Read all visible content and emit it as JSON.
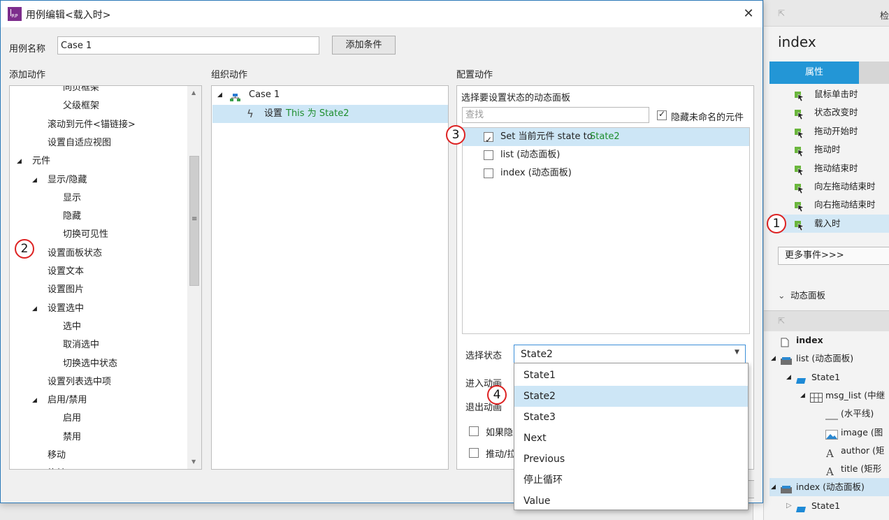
{
  "dialog": {
    "title": "用例编辑<载入时>",
    "case_name_label": "用例名称",
    "case_name_value": "Case 1",
    "add_condition_button": "添加条件",
    "col_add_action": "添加动作",
    "col_organize_action": "组织动作",
    "col_configure_action": "配置动作"
  },
  "add_action_tree": [
    {
      "label": "同页框架",
      "indent": 3,
      "expander": ""
    },
    {
      "label": "父级框架",
      "indent": 3,
      "expander": ""
    },
    {
      "label": "滚动到元件<锚链接>",
      "indent": 2,
      "expander": ""
    },
    {
      "label": "设置自适应视图",
      "indent": 2,
      "expander": ""
    },
    {
      "label": "元件",
      "indent": 1,
      "expander": "◢"
    },
    {
      "label": "显示/隐藏",
      "indent": 2,
      "expander": "◢"
    },
    {
      "label": "显示",
      "indent": 3,
      "expander": ""
    },
    {
      "label": "隐藏",
      "indent": 3,
      "expander": ""
    },
    {
      "label": "切换可见性",
      "indent": 3,
      "expander": ""
    },
    {
      "label": "设置面板状态",
      "indent": 2,
      "expander": ""
    },
    {
      "label": "设置文本",
      "indent": 2,
      "expander": ""
    },
    {
      "label": "设置图片",
      "indent": 2,
      "expander": ""
    },
    {
      "label": "设置选中",
      "indent": 2,
      "expander": "◢"
    },
    {
      "label": "选中",
      "indent": 3,
      "expander": ""
    },
    {
      "label": "取消选中",
      "indent": 3,
      "expander": ""
    },
    {
      "label": "切换选中状态",
      "indent": 3,
      "expander": ""
    },
    {
      "label": "设置列表选中项",
      "indent": 2,
      "expander": ""
    },
    {
      "label": "启用/禁用",
      "indent": 2,
      "expander": "◢"
    },
    {
      "label": "启用",
      "indent": 3,
      "expander": ""
    },
    {
      "label": "禁用",
      "indent": 3,
      "expander": ""
    },
    {
      "label": "移动",
      "indent": 2,
      "expander": ""
    },
    {
      "label": "旋转",
      "indent": 2,
      "expander": ""
    }
  ],
  "organize": {
    "case_label": "Case 1",
    "action_prefix": "设置",
    "action_target": "This 为 State2"
  },
  "configure": {
    "panel_title": "选择要设置状态的动态面板",
    "search_placeholder": "查找",
    "hide_unnamed_label": "隐藏未命名的元件",
    "items": [
      {
        "prefix": "Set 当前元件 state to ",
        "suffix": "State2",
        "checked": true
      },
      {
        "prefix": "list (动态面板)",
        "suffix": "",
        "checked": false
      },
      {
        "prefix": "index (动态面板)",
        "suffix": "",
        "checked": false
      }
    ],
    "select_state_label": "选择状态",
    "select_state_value": "State2",
    "enter_anim_label": "进入动画",
    "exit_anim_label": "退出动画",
    "if_hidden_label": "如果隐",
    "push_label": "推动/拉"
  },
  "state_dropdown": {
    "options": [
      "State1",
      "State2",
      "State3",
      "Next",
      "Previous",
      "停止循环",
      "Value"
    ],
    "selected": "State2"
  },
  "badges": [
    "1",
    "2",
    "3",
    "4"
  ],
  "right_panel": {
    "header_cut": "检",
    "title": "index",
    "tab_active": "属性",
    "events": [
      "鼠标单击时",
      "状态改变时",
      "拖动开始时",
      "拖动时",
      "拖动结束时",
      "向左拖动结束时",
      "向右拖动结束时",
      "载入时"
    ],
    "selected_event": "载入时",
    "more_events": "更多事件>>>",
    "section_dynamic_panel": "动态面板",
    "outline": [
      {
        "label": "index",
        "indent": 0,
        "icon": "page-icon",
        "bold": true
      },
      {
        "label": "list (动态面板)",
        "indent": 0,
        "icon": "dynamic-panel-icon",
        "bold": false
      },
      {
        "label": "State1",
        "indent": 1,
        "icon": "state-icon",
        "bold": false
      },
      {
        "label": "msg_list (中继",
        "indent": 2,
        "icon": "repeater-icon",
        "bold": false
      },
      {
        "label": "(水平线)",
        "indent": 3,
        "icon": "line-icon",
        "bold": false
      },
      {
        "label": "image (图",
        "indent": 3,
        "icon": "image-icon",
        "bold": false
      },
      {
        "label": "author (矩",
        "indent": 3,
        "icon": "text-icon",
        "bold": false
      },
      {
        "label": "title (矩形",
        "indent": 3,
        "icon": "text-icon",
        "bold": false
      },
      {
        "label": "index (动态面板)",
        "indent": 0,
        "icon": "dynamic-panel-icon",
        "bold": false
      },
      {
        "label": "State1",
        "indent": 1,
        "icon": "state-icon",
        "bold": false
      }
    ]
  },
  "colors": {
    "accent": "#2396d6",
    "selection": "#cde6f6",
    "green_text": "#1e8e2e",
    "badge_border": "#dd2222"
  }
}
